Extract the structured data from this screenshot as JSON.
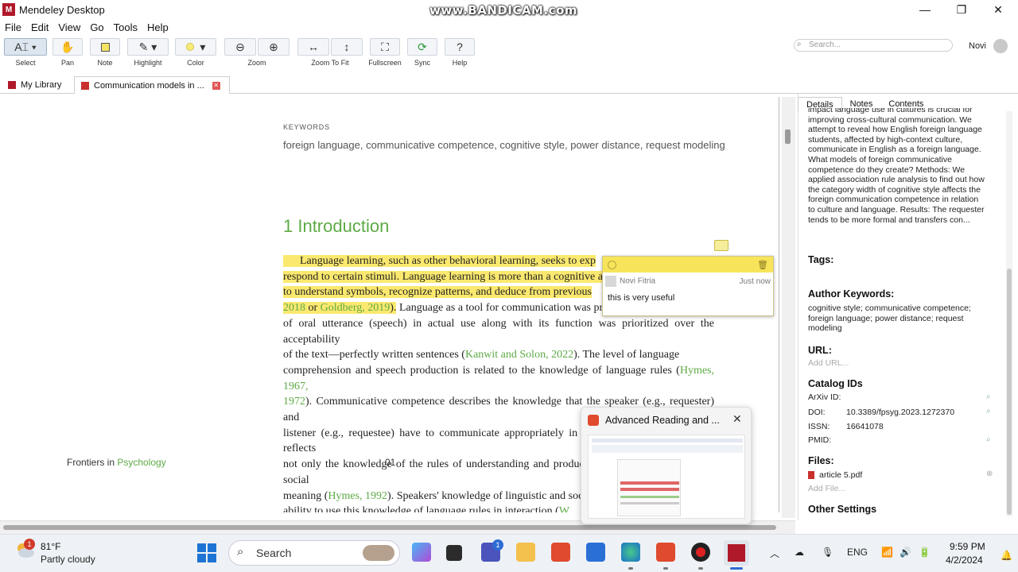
{
  "window": {
    "title": "Mendeley Desktop",
    "watermark": "www.BANDICAM.com"
  },
  "menu": [
    "File",
    "Edit",
    "View",
    "Go",
    "Tools",
    "Help"
  ],
  "toolbar": {
    "select": "Select",
    "pan": "Pan",
    "note": "Note",
    "highlight": "Highlight",
    "color": "Color",
    "zoom": "Zoom",
    "zoom_to_fit": "Zoom To Fit",
    "fullscreen": "Fullscreen",
    "sync": "Sync",
    "help": "Help"
  },
  "search": {
    "placeholder": "Search..."
  },
  "user": {
    "name": "Novi"
  },
  "tabs": {
    "library": "My Library",
    "document": "Communication models in ..."
  },
  "document": {
    "keywords_heading": "KEYWORDS",
    "keywords": "foreign language, communicative competence, cognitive style, power distance, request modeling",
    "section_title": "1 Introduction",
    "para": {
      "p1": "Language learning, such as other behavioral learning, seeks to exp",
      "p2": "respond to certain stimuli. Language learning is more than a cognitive ab",
      "p3": "to understand symbols, recognize patterns, and deduce from previous",
      "p4a": "2018",
      "p4b": " or ",
      "p4c": "Goldberg, 2019",
      "p4d": ").",
      "p4e": " Language as a tool for communication was priv",
      "l5": "of oral utterance (speech) in actual use along with its function was prioritized over the acceptability",
      "l6a": "of the text—perfectly written sentences (",
      "l6b": "Kanwit and Solon, 2022",
      "l6c": "). The level of language",
      "l7a": "comprehension and speech production is related to the knowledge of language rules (",
      "l7b": "Hymes, 1967,",
      "l8a": "1972",
      "l8b": "). Communicative competence describes the knowledge that the speaker (e.g., requester) and",
      "l9": "listener (e.g., requestee) have to communicate appropriately in different social situations. It reflects",
      "l10": "not only the knowledge of the rules of understanding and production of language but also its social",
      "l11a": "meaning (",
      "l11b": "Hymes, 1992",
      "l11c": "). Speakers' knowledge of linguistic and socio",
      "l12a": "ability to use this knowledge of language rules in interaction (",
      "l12b": "W"
    },
    "footer_left_a": "Frontiers in ",
    "footer_left_b": "Psychology",
    "footer_page": "01"
  },
  "note": {
    "author": "Novi Fitria",
    "time": "Just now",
    "text": "this is very useful"
  },
  "details": {
    "tabs": [
      "Details",
      "Notes",
      "Contents"
    ],
    "abstract": "impact language use in cultures is crucial for improving cross-cultural communication. We attempt to reveal how English foreign language students, affected by high-context culture, communicate in English as a foreign language. What models of foreign communicative competence do they create? Methods: We applied association rule analysis to find out how the category width of cognitive style affects the foreign communication competence in relation to culture and language. Results: The requester tends to be more formal and transfers con...",
    "tags_h": "Tags:",
    "author_kw_h": "Author Keywords:",
    "author_kw": "cognitive style; communicative competence; foreign language; power distance; request modeling",
    "url_h": "URL:",
    "add_url": "Add URL...",
    "catalog_h": "Catalog IDs",
    "arxiv_l": "ArXiv ID:",
    "doi_l": "DOI:",
    "doi_v": "10.3389/fpsyg.2023.1272370",
    "issn_l": "ISSN:",
    "issn_v": "16641078",
    "pmid_l": "PMID:",
    "files_h": "Files:",
    "file": "article 5.pdf",
    "add_file": "Add File...",
    "other_h": "Other Settings"
  },
  "preview": {
    "title": "Advanced Reading and ..."
  },
  "taskbar": {
    "weather_badge": "1",
    "temp": "81°F",
    "condition": "Partly cloudy",
    "search": "Search",
    "lang": "ENG",
    "time": "9:59 PM",
    "date": "4/2/2024",
    "teams_badge": "1"
  },
  "colors": {
    "highlight": "#fbe96f",
    "link_green": "#5daa45",
    "mendeley_red": "#b0192a"
  }
}
